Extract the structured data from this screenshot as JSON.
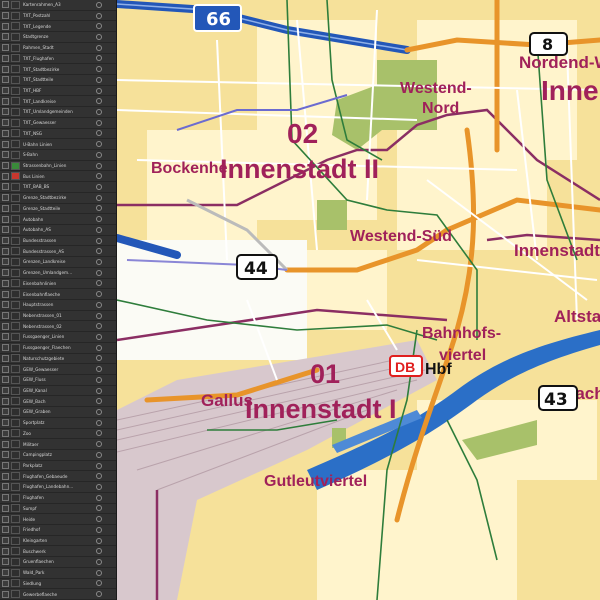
{
  "layers": [
    {
      "label": "Kartenrahmen_A3",
      "swatch": "#2f2f2f"
    },
    {
      "label": "TXT_Postzahl",
      "swatch": "#2f2f2f"
    },
    {
      "label": "TXT_Legende",
      "swatch": "#2f2f2f"
    },
    {
      "label": "Stadtgrenze",
      "swatch": "#2f2f2f"
    },
    {
      "label": "Rahmen_Stadt",
      "swatch": "#2f2f2f"
    },
    {
      "label": "TXT_Flughafen",
      "swatch": "#2f2f2f"
    },
    {
      "label": "TXT_Stadtbezirke",
      "swatch": "#2f2f2f"
    },
    {
      "label": "TXT_Stadtteile",
      "swatch": "#2f2f2f"
    },
    {
      "label": "TXT_HBF",
      "swatch": "#2f2f2f"
    },
    {
      "label": "TXT_Landkreise",
      "swatch": "#2f2f2f"
    },
    {
      "label": "TXT_Umlandgemeinden",
      "swatch": "#2f2f2f"
    },
    {
      "label": "TXT_Gewaesser",
      "swatch": "#2f2f2f"
    },
    {
      "label": "TXT_NSG",
      "swatch": "#2f2f2f"
    },
    {
      "label": "U-Bahn Linien",
      "swatch": "#2f2f2f"
    },
    {
      "label": "S-Bahn",
      "swatch": "#2f2f2f"
    },
    {
      "label": "Strassenbahn_Linien",
      "swatch": "#3a8a3a"
    },
    {
      "label": "Bus Linien",
      "swatch": "#c8382e"
    },
    {
      "label": "TXT_BAB_BS",
      "swatch": "#2f2f2f"
    },
    {
      "label": "Grenze_Stadtbezirke",
      "swatch": "#2f2f2f"
    },
    {
      "label": "Grenze_Stadtteile",
      "swatch": "#2f2f2f"
    },
    {
      "label": "Autobahn",
      "swatch": "#2f2f2f"
    },
    {
      "label": "Autobahn_AS",
      "swatch": "#2f2f2f"
    },
    {
      "label": "Bundesstrassen",
      "swatch": "#2f2f2f"
    },
    {
      "label": "Bundesstrassen_AS",
      "swatch": "#2f2f2f"
    },
    {
      "label": "Grenzen_Landkreise",
      "swatch": "#2f2f2f"
    },
    {
      "label": "Grenzen_Umlandgem...",
      "swatch": "#2f2f2f"
    },
    {
      "label": "Eisenbahnlinien",
      "swatch": "#2f2f2f"
    },
    {
      "label": "Eisenbahnflaeche",
      "swatch": "#2f2f2f"
    },
    {
      "label": "Hauptstrassen",
      "swatch": "#2f2f2f"
    },
    {
      "label": "Nebenstrassen_01",
      "swatch": "#2f2f2f"
    },
    {
      "label": "Nebenstrassen_02",
      "swatch": "#2f2f2f"
    },
    {
      "label": "Fussgaenger_Linien",
      "swatch": "#2f2f2f"
    },
    {
      "label": "Fussgaenger_Flaechen",
      "swatch": "#2f2f2f"
    },
    {
      "label": "Naturschutzgebiete",
      "swatch": "#2f2f2f"
    },
    {
      "label": "GEW_Gewaesser",
      "swatch": "#2f2f2f"
    },
    {
      "label": "GEW_Fluss",
      "swatch": "#2f2f2f"
    },
    {
      "label": "GEW_Kanal",
      "swatch": "#2f2f2f"
    },
    {
      "label": "GEW_Bach",
      "swatch": "#2f2f2f"
    },
    {
      "label": "GEW_Graben",
      "swatch": "#2f2f2f"
    },
    {
      "label": "Sportplatz",
      "swatch": "#2f2f2f"
    },
    {
      "label": "Zoo",
      "swatch": "#2f2f2f"
    },
    {
      "label": "Militaer",
      "swatch": "#2f2f2f"
    },
    {
      "label": "Campingplatz",
      "swatch": "#2f2f2f"
    },
    {
      "label": "Parkplatz",
      "swatch": "#2f2f2f"
    },
    {
      "label": "Flughafen_Gebaeude",
      "swatch": "#2f2f2f"
    },
    {
      "label": "Flughafen_Landebahn...",
      "swatch": "#2f2f2f"
    },
    {
      "label": "Flughafen",
      "swatch": "#2f2f2f"
    },
    {
      "label": "Sumpf",
      "swatch": "#2f2f2f"
    },
    {
      "label": "Heide",
      "swatch": "#2f2f2f"
    },
    {
      "label": "Friedhof",
      "swatch": "#2f2f2f"
    },
    {
      "label": "Kleingarten",
      "swatch": "#2f2f2f"
    },
    {
      "label": "Buschwerk",
      "swatch": "#2f2f2f"
    },
    {
      "label": "Gruenflaechen",
      "swatch": "#2f2f2f"
    },
    {
      "label": "Wald_Park",
      "swatch": "#2f2f2f"
    },
    {
      "label": "Siedlung",
      "swatch": "#2f2f2f"
    },
    {
      "label": "Gewerbeflaeche",
      "swatch": "#2f2f2f"
    }
  ],
  "map": {
    "colors": {
      "settlement": "#f6e19a",
      "commercial": "#e9d48a",
      "blocks": "#fff7d6",
      "rail_area": "#d9c9cf",
      "water": "#2b6fc7",
      "park": "#a9c26a",
      "boundary": "#8b2e63",
      "autobahn": "#2357b8",
      "main_road": "#e8942a",
      "tram": "#2e7d3b"
    },
    "labels": {
      "westend_nord_1": "Westend-",
      "westend_nord_2": "Nord",
      "nordend_1": "Nordend-W",
      "nordend_2": "Inne",
      "district_02_num": "02",
      "district_02_name": "Innenstadt II",
      "bockenheim": "Bockenhe",
      "westend_sued": "Westend-Süd",
      "innenstadt_right": "Innenstadt",
      "altstadt": "Altstad",
      "bahnhofsviertel_1": "Bahnhofs-",
      "bahnhofsviertel_2": "viertel",
      "district_01_num": "01",
      "gallus": "Gallus",
      "district_01_name": "Innenstadt I",
      "gutleutviertel": "Gutleutviertel",
      "sachsenhausen": "Sach",
      "hbf": "Hbf",
      "db_logo": "DB"
    },
    "shields": {
      "a66": "66",
      "b8": "8",
      "b44": "44",
      "b43": "43"
    }
  }
}
